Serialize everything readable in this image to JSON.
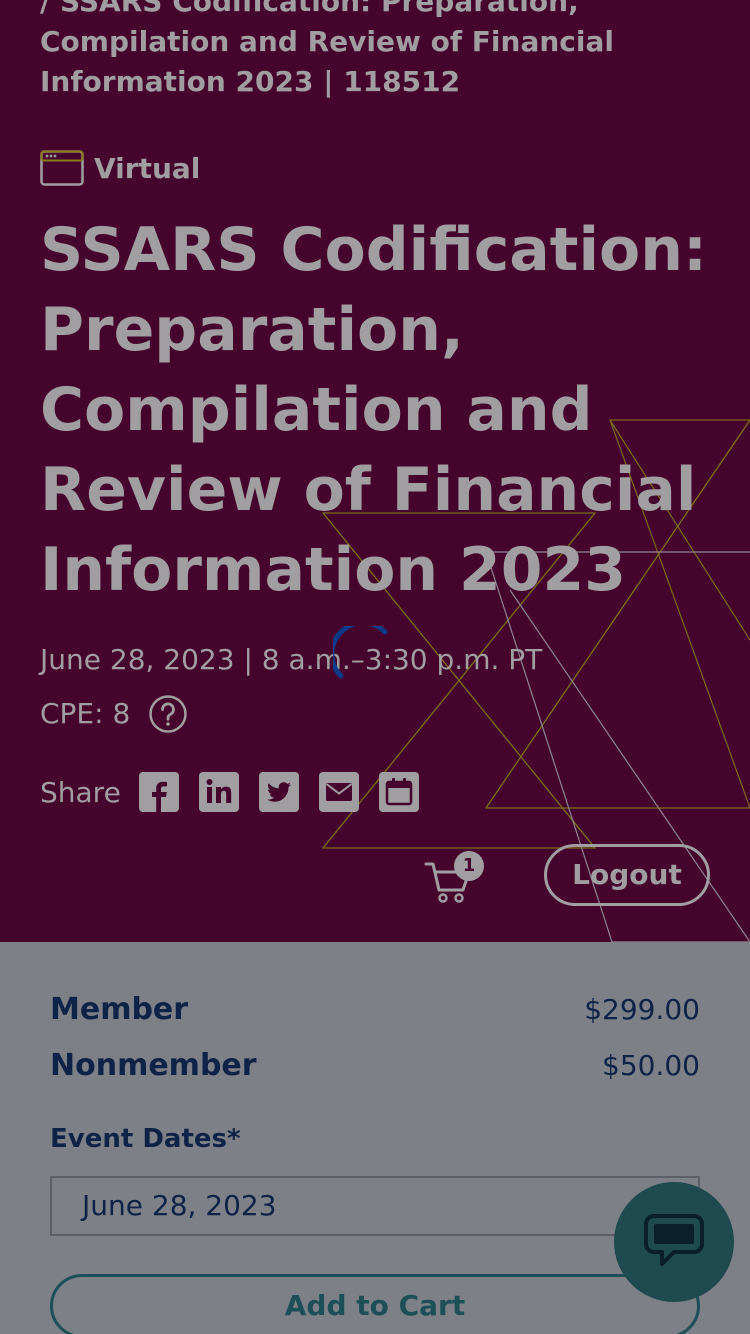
{
  "breadcrumb": {
    "line1": "/ SSARS Codification: Preparation,",
    "line2": "Compilation and Review of Financial",
    "line3": "Information 2023 | 118512"
  },
  "event": {
    "format_label": "Virtual",
    "format_icon": "browser-window-icon",
    "title": "SSARS Codification: Preparation, Compilation and Review of Financial Information 2023",
    "when": "June 28, 2023 | 8 a.m.–3:30 p.m. PT",
    "cpe_label": "CPE: 8",
    "help_icon": "question-circle-icon"
  },
  "share": {
    "label": "Share",
    "icons": [
      "facebook-icon",
      "linkedin-icon",
      "twitter-icon",
      "email-icon",
      "calendar-icon"
    ]
  },
  "header_actions": {
    "cart_count": "1",
    "logout_label": "Logout"
  },
  "pricing": {
    "member_label": "Member",
    "member_price": "$299.00",
    "nonmember_label": "Nonmember",
    "nonmember_price": "$50.00"
  },
  "event_dates": {
    "label": "Event Dates*",
    "selected": "June 28, 2023"
  },
  "cart": {
    "add_label": "Add to Cart"
  },
  "colors": {
    "hero_bg": "#44042b",
    "overlay_text": "#a19ea1",
    "navy_text": "#0e2347",
    "teal": "#1c4f57",
    "spinner": "#0b3a8a",
    "accent_line": "#8a7a1a"
  }
}
